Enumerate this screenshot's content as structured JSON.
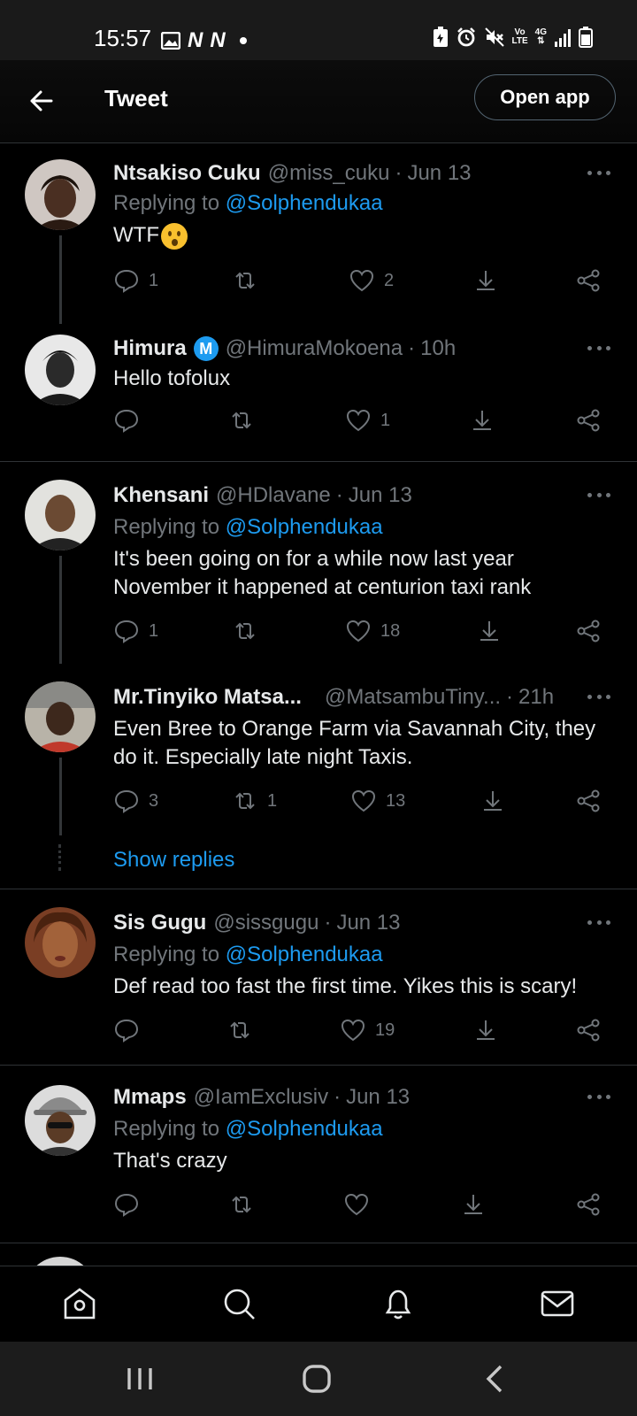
{
  "status_bar": {
    "time": "15:57",
    "left_icons": [
      "gallery-icon",
      "netflix-icon",
      "netflix-icon",
      "dot-icon"
    ],
    "netflix_letter": "N",
    "volte_top": "Vo",
    "volte_bottom": "LTE",
    "network": "4G",
    "right_icons": [
      "battery-saver-icon",
      "alarm-icon",
      "mute-icon",
      "volte-icon",
      "network-4g-icon",
      "signal-icon",
      "battery-icon"
    ]
  },
  "header": {
    "title": "Tweet",
    "open_app_label": "Open app"
  },
  "tweets": [
    {
      "name": "Ntsakiso Cuku",
      "handle": "@miss_cuku",
      "time": "Jun 13",
      "replying_prefix": "Replying to",
      "replying_to": "@Solphendukaa",
      "text": "WTF",
      "emoji": "hushed-face-emoji",
      "replies": "1",
      "retweets": "",
      "likes": "2"
    },
    {
      "name": "Himura",
      "verified_label": "M",
      "handle": "@HimuraMokoena",
      "time": "10h",
      "text": "Hello tofolux",
      "replies": "",
      "retweets": "",
      "likes": "1"
    },
    {
      "name": "Khensani",
      "handle": "@HDlavane",
      "time": "Jun 13",
      "replying_prefix": "Replying to",
      "replying_to": "@Solphendukaa",
      "text": "It's been going on for a while now last year November it happened at centurion taxi rank",
      "replies": "1",
      "retweets": "",
      "likes": "18"
    },
    {
      "name": "Mr.Tinyiko Matsa...",
      "handle": "@MatsambuTiny...",
      "time": "21h",
      "text": "Even  Bree to Orange Farm via Savannah City, they do it. Especially late night Taxis.",
      "replies": "3",
      "retweets": "1",
      "likes": "13"
    },
    {
      "name": "Sis Gugu",
      "handle": "@sissgugu",
      "time": "Jun 13",
      "replying_prefix": "Replying to",
      "replying_to": "@Solphendukaa",
      "text": "Def read too fast the first time. Yikes this is scary!",
      "replies": "",
      "retweets": "",
      "likes": "19"
    },
    {
      "name": "Mmaps",
      "handle": "@IamExclusiv",
      "time": "Jun 13",
      "replying_prefix": "Replying to",
      "replying_to": "@Solphendukaa",
      "text": "That's crazy",
      "replies": "",
      "retweets": "",
      "likes": ""
    }
  ],
  "separator": "·",
  "show_replies": "Show replies",
  "bottom_nav": [
    "home-icon",
    "search-icon",
    "notifications-icon",
    "messages-icon"
  ],
  "system_nav": [
    "recents-icon",
    "home-circle-icon",
    "back-chevron-icon"
  ],
  "colors": {
    "background": "#000000",
    "accent": "#1d9bf0",
    "muted_text": "#71767b",
    "divider": "#2f3336"
  }
}
